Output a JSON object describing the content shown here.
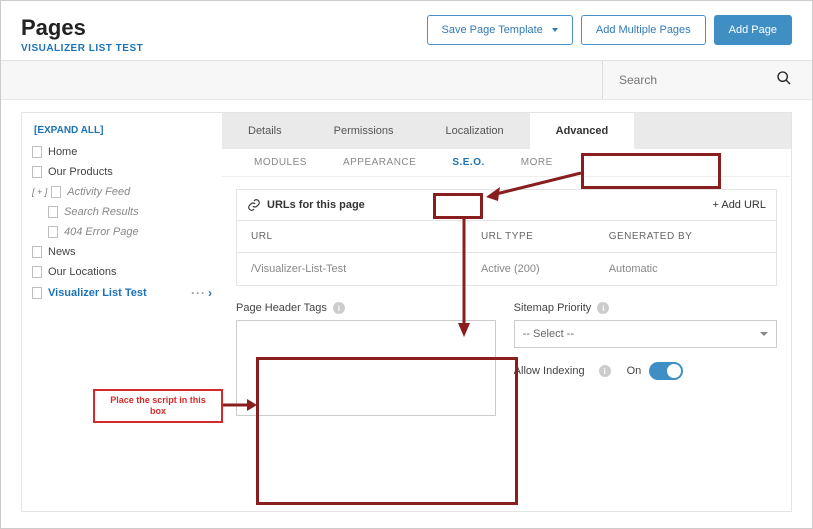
{
  "header": {
    "title": "Pages",
    "subtitle": "VISUALIZER LIST TEST",
    "buttons": {
      "saveTemplate": "Save Page Template",
      "addMultiple": "Add Multiple Pages",
      "addPage": "Add Page"
    }
  },
  "search": {
    "placeholder": "Search"
  },
  "sidebar": {
    "expandAll": "[EXPAND ALL]",
    "items": [
      {
        "label": "Home",
        "indent": 0
      },
      {
        "label": "Our Products",
        "indent": 0
      },
      {
        "label": "Activity Feed",
        "indent": 0,
        "italic": true,
        "prefix": true
      },
      {
        "label": "Search Results",
        "indent": 1,
        "italic": true
      },
      {
        "label": "404 Error Page",
        "indent": 1,
        "italic": true
      },
      {
        "label": "News",
        "indent": 0
      },
      {
        "label": "Our Locations",
        "indent": 0
      },
      {
        "label": "Visualizer List Test",
        "indent": 0,
        "active": true
      }
    ]
  },
  "primaryTabs": [
    {
      "label": "Details"
    },
    {
      "label": "Permissions"
    },
    {
      "label": "Localization"
    },
    {
      "label": "Advanced",
      "active": true
    }
  ],
  "secondaryTabs": [
    {
      "label": "MODULES"
    },
    {
      "label": "APPEARANCE"
    },
    {
      "label": "S.E.O.",
      "active": true
    },
    {
      "label": "MORE"
    }
  ],
  "urls": {
    "sectionTitle": "URLs for this page",
    "addLabel": "+  Add URL",
    "columns": {
      "url": "URL",
      "type": "URL TYPE",
      "generated": "GENERATED BY"
    },
    "rows": [
      {
        "url": "/Visualizer-List-Test",
        "type": "Active (200)",
        "generated": "Automatic"
      }
    ]
  },
  "form": {
    "pageHeaderTags": "Page Header Tags",
    "sitemapPriority": "Sitemap Priority",
    "sitemapSelected": "-- Select --",
    "allowIndexing": "Allow Indexing",
    "allowIndexingState": "On"
  },
  "annotation": {
    "callout": "Place the script in this box"
  }
}
